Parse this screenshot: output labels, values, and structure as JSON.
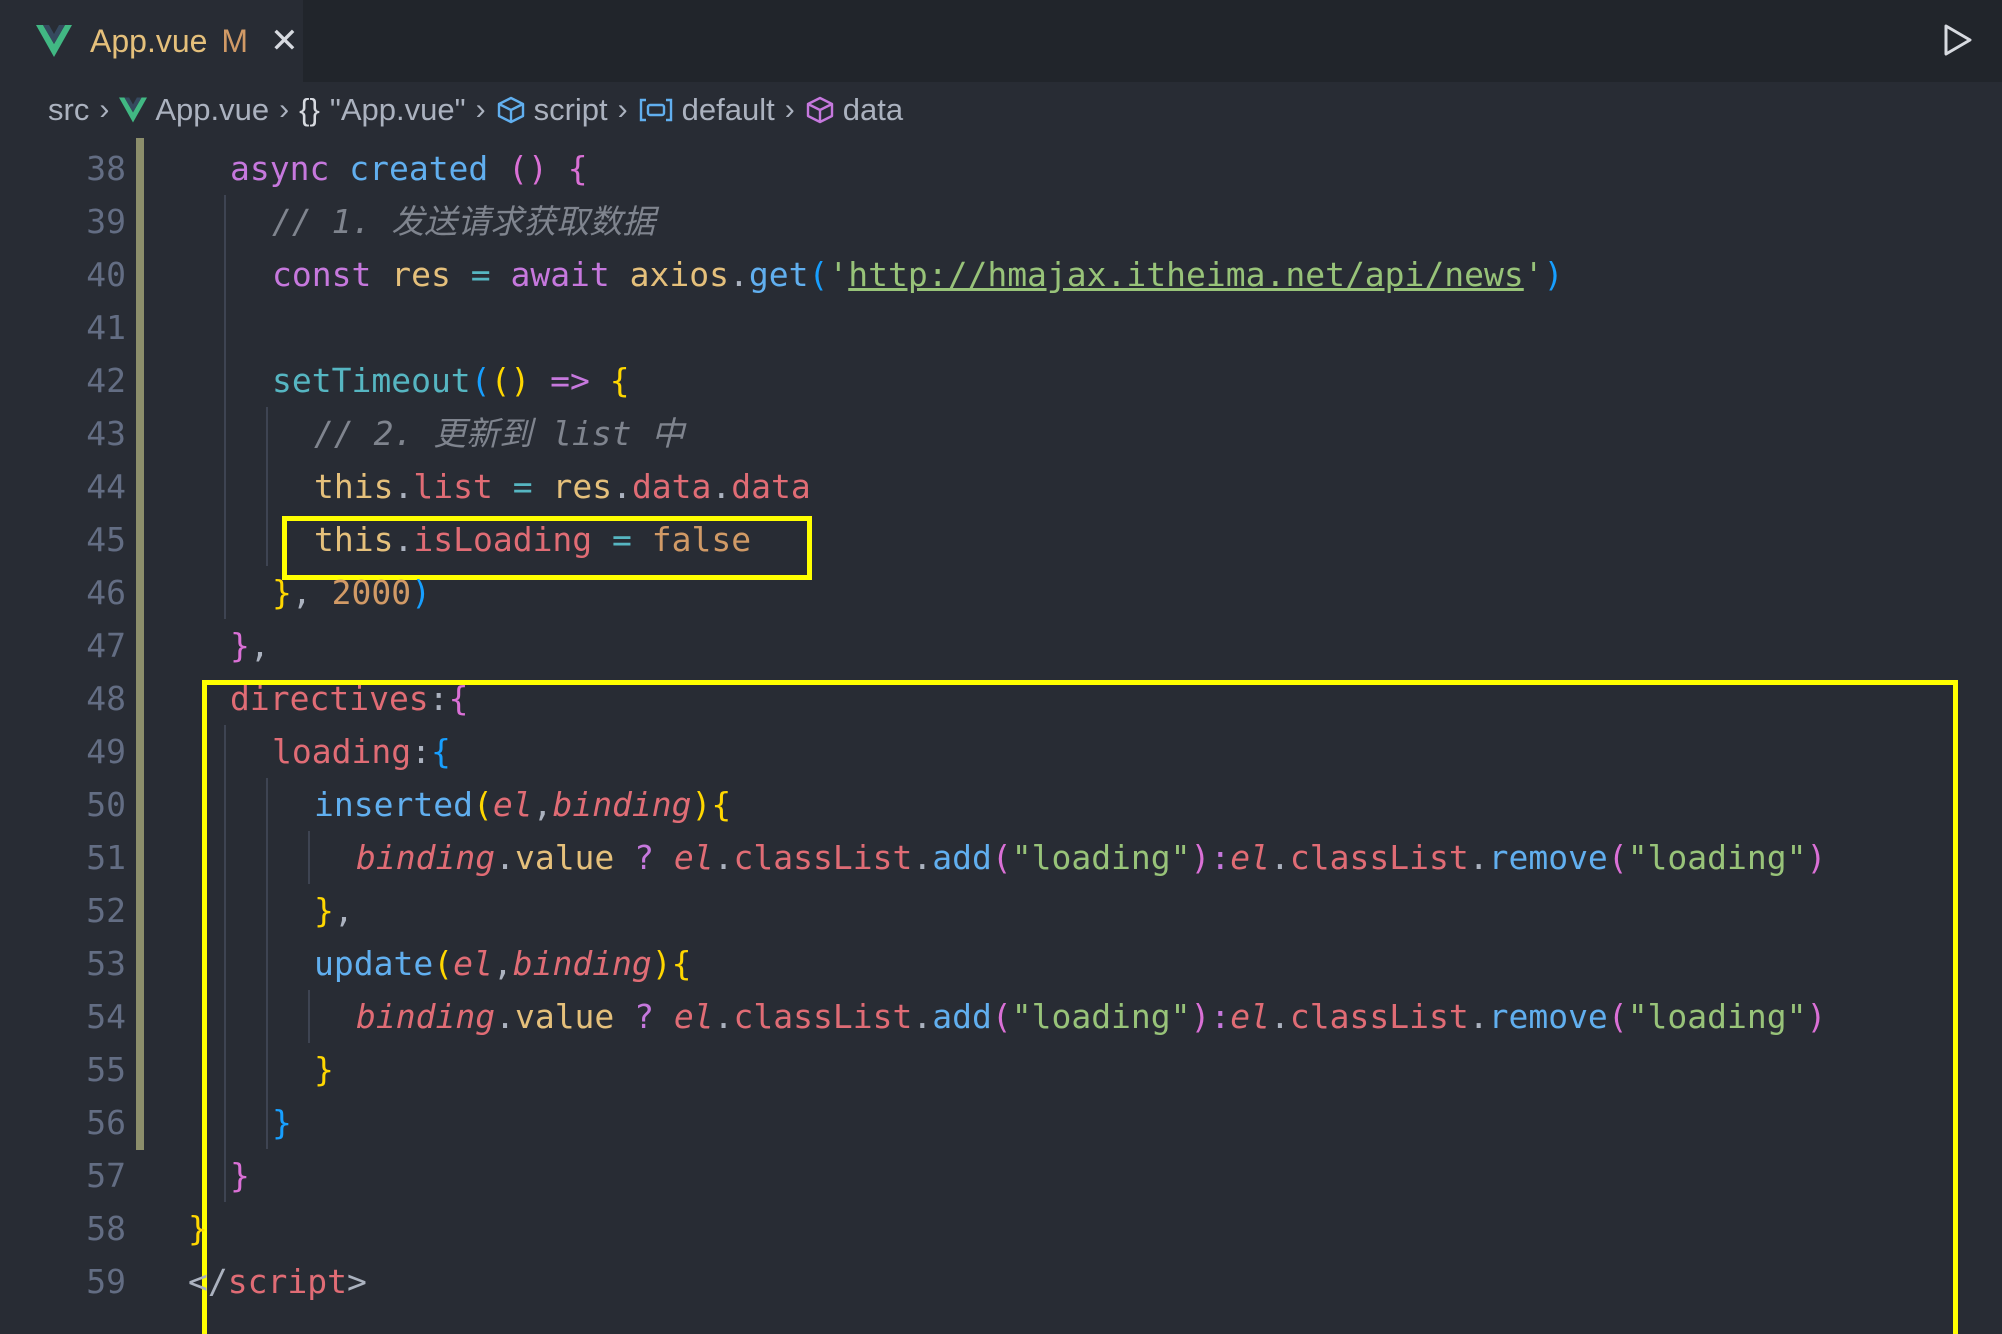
{
  "tab": {
    "filename": "App.vue",
    "status": "M",
    "close_glyph": "✕"
  },
  "breadcrumb": {
    "items": [
      "src",
      "App.vue",
      "\"App.vue\"",
      "script",
      "default",
      "data"
    ],
    "braces": "{}"
  },
  "editor": {
    "lines": [
      {
        "n": "38",
        "t": [
          [
            "kw",
            "async "
          ],
          [
            "fn",
            "created "
          ],
          [
            "b2",
            "() "
          ],
          [
            "b2",
            "{"
          ]
        ]
      },
      {
        "n": "39",
        "t": [
          [
            "cmt",
            "// 1. 发送请求获取数据"
          ]
        ]
      },
      {
        "n": "40",
        "t": [
          [
            "kw",
            "const "
          ],
          [
            "var",
            "res "
          ],
          [
            "op",
            "= "
          ],
          [
            "kw",
            "await "
          ],
          [
            "var",
            "axios"
          ],
          [
            "pun",
            "."
          ],
          [
            "fn",
            "get"
          ],
          [
            "b3",
            "("
          ],
          [
            "str",
            "'"
          ],
          [
            "url",
            "http://hmajax.itheima.net/api/news"
          ],
          [
            "str",
            "'"
          ],
          [
            "b3",
            ")"
          ]
        ]
      },
      {
        "n": "41",
        "t": []
      },
      {
        "n": "42",
        "t": [
          [
            "op",
            "setTimeout"
          ],
          [
            "b3",
            "("
          ],
          [
            "b1",
            "() "
          ],
          [
            "kw",
            "=> "
          ],
          [
            "b1",
            "{"
          ]
        ]
      },
      {
        "n": "43",
        "t": [
          [
            "cmt",
            "// 2. 更新到 list 中"
          ]
        ]
      },
      {
        "n": "44",
        "t": [
          [
            "var",
            "this"
          ],
          [
            "pun",
            "."
          ],
          [
            "prp",
            "list "
          ],
          [
            "op",
            "= "
          ],
          [
            "var",
            "res"
          ],
          [
            "pun",
            "."
          ],
          [
            "prp",
            "data"
          ],
          [
            "pun",
            "."
          ],
          [
            "prp",
            "data"
          ]
        ]
      },
      {
        "n": "45",
        "t": [
          [
            "var",
            "this"
          ],
          [
            "pun",
            "."
          ],
          [
            "prp",
            "isLoading "
          ],
          [
            "op",
            "= "
          ],
          [
            "num",
            "false"
          ]
        ]
      },
      {
        "n": "46",
        "t": [
          [
            "b1",
            "}"
          ],
          [
            "pun",
            ", "
          ],
          [
            "num",
            "2000"
          ],
          [
            "b3",
            ")"
          ]
        ]
      },
      {
        "n": "47",
        "t": [
          [
            "b2",
            "}"
          ],
          [
            "pun",
            ","
          ]
        ]
      },
      {
        "n": "48",
        "t": [
          [
            "prp",
            "directives"
          ],
          [
            "pun",
            ":"
          ],
          [
            "b2",
            "{"
          ]
        ]
      },
      {
        "n": "49",
        "t": [
          [
            "prp",
            "loading"
          ],
          [
            "pun",
            ":"
          ],
          [
            "b3",
            "{"
          ]
        ]
      },
      {
        "n": "50",
        "t": [
          [
            "fn",
            "inserted"
          ],
          [
            "b1",
            "("
          ],
          [
            "par",
            "el"
          ],
          [
            "pun",
            ","
          ],
          [
            "par",
            "binding"
          ],
          [
            "b1",
            ")"
          ],
          [
            "b1",
            "{"
          ]
        ]
      },
      {
        "n": "51",
        "t": [
          [
            "par",
            "binding"
          ],
          [
            "pun",
            "."
          ],
          [
            "var",
            "value "
          ],
          [
            "kw",
            "? "
          ],
          [
            "par",
            "el"
          ],
          [
            "pun",
            "."
          ],
          [
            "prp",
            "classList"
          ],
          [
            "pun",
            "."
          ],
          [
            "fn",
            "add"
          ],
          [
            "b2",
            "("
          ],
          [
            "str",
            "\"loading\""
          ],
          [
            "b2",
            ")"
          ],
          [
            "kw",
            ":"
          ],
          [
            "par",
            "el"
          ],
          [
            "pun",
            "."
          ],
          [
            "prp",
            "classList"
          ],
          [
            "pun",
            "."
          ],
          [
            "fn",
            "remove"
          ],
          [
            "b2",
            "("
          ],
          [
            "str",
            "\"loading\""
          ],
          [
            "b2",
            ")"
          ]
        ]
      },
      {
        "n": "52",
        "t": [
          [
            "b1",
            "}"
          ],
          [
            "pun",
            ","
          ]
        ]
      },
      {
        "n": "53",
        "t": [
          [
            "fn",
            "update"
          ],
          [
            "b1",
            "("
          ],
          [
            "par",
            "el"
          ],
          [
            "pun",
            ","
          ],
          [
            "par",
            "binding"
          ],
          [
            "b1",
            ")"
          ],
          [
            "b1",
            "{"
          ]
        ]
      },
      {
        "n": "54",
        "t": [
          [
            "par",
            "binding"
          ],
          [
            "pun",
            "."
          ],
          [
            "var",
            "value "
          ],
          [
            "kw",
            "? "
          ],
          [
            "par",
            "el"
          ],
          [
            "pun",
            "."
          ],
          [
            "prp",
            "classList"
          ],
          [
            "pun",
            "."
          ],
          [
            "fn",
            "add"
          ],
          [
            "b2",
            "("
          ],
          [
            "str",
            "\"loading\""
          ],
          [
            "b2",
            ")"
          ],
          [
            "kw",
            ":"
          ],
          [
            "par",
            "el"
          ],
          [
            "pun",
            "."
          ],
          [
            "prp",
            "classList"
          ],
          [
            "pun",
            "."
          ],
          [
            "fn",
            "remove"
          ],
          [
            "b2",
            "("
          ],
          [
            "str",
            "\"loading\""
          ],
          [
            "b2",
            ")"
          ]
        ]
      },
      {
        "n": "55",
        "t": [
          [
            "b1",
            "}"
          ]
        ]
      },
      {
        "n": "56",
        "t": [
          [
            "b3",
            "}"
          ]
        ]
      },
      {
        "n": "57",
        "t": [
          [
            "b2",
            "}"
          ]
        ]
      },
      {
        "n": "58",
        "t": [
          [
            "b1",
            "}"
          ]
        ]
      },
      {
        "n": "59",
        "t": [
          [
            "pun",
            "</"
          ],
          [
            "tag",
            "script"
          ],
          [
            "pun",
            ">"
          ]
        ]
      }
    ]
  }
}
